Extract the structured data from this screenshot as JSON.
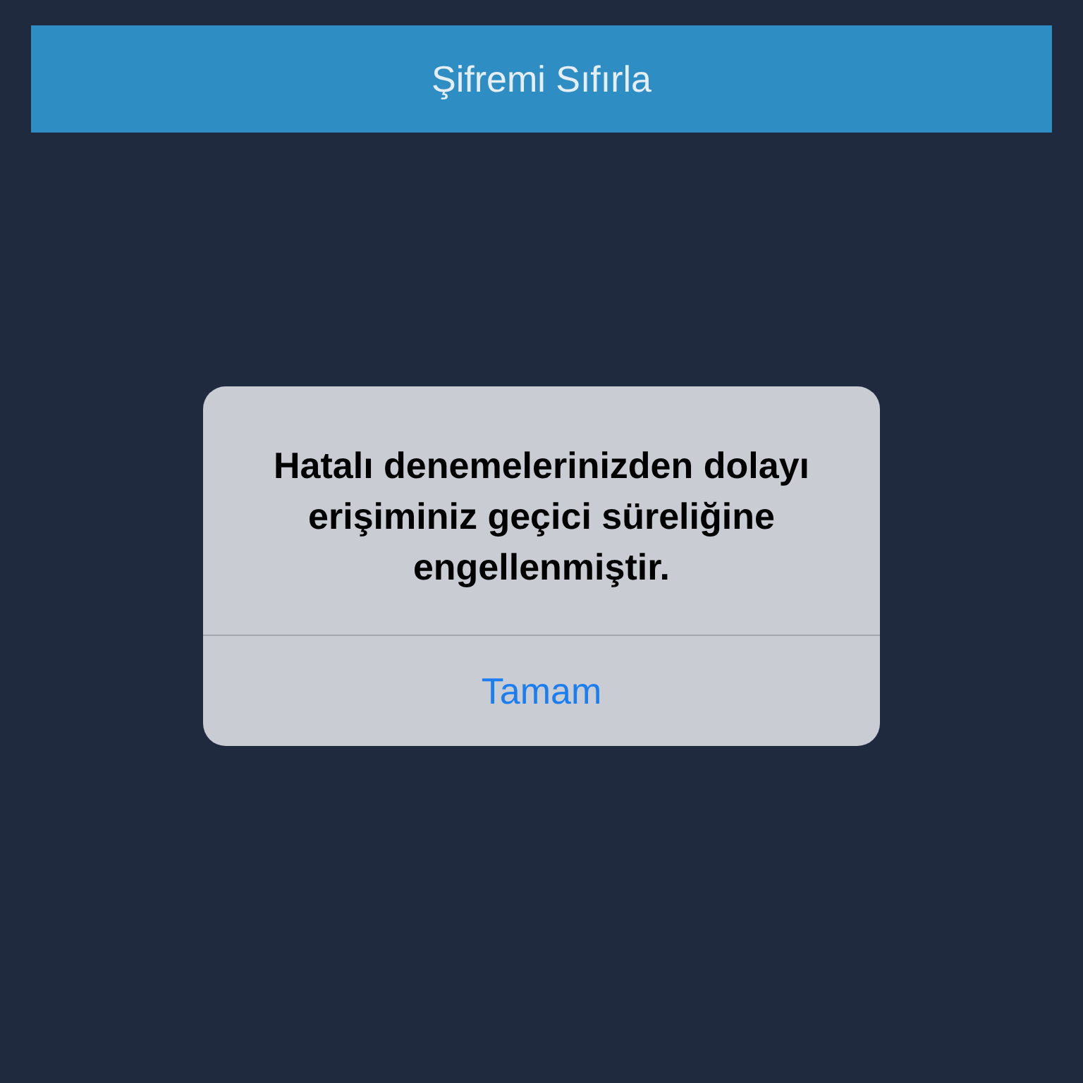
{
  "header": {
    "title": "Şifremi Sıfırla"
  },
  "alert": {
    "message": "Hatalı denemelerinizden dolayı erişiminiz geçici süreliğine engellenmiştir.",
    "buttons": [
      "Tamam"
    ]
  }
}
